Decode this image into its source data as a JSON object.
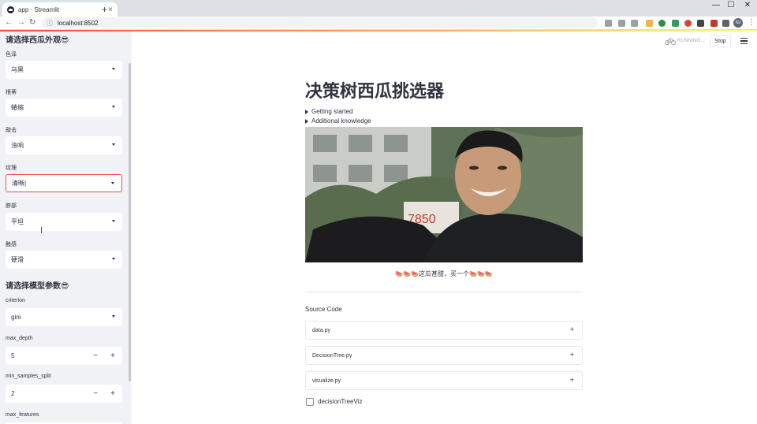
{
  "browser": {
    "tab_title": "app · Streamlit",
    "tab_close": "×",
    "new_tab": "+",
    "url": "localhost:8502",
    "win_min": "—",
    "win_max": "☐",
    "win_close": "✕",
    "nav_back": "←",
    "nav_forward": "→",
    "nav_reload": "↻",
    "more": "⋮",
    "profile_initials": "NJ"
  },
  "sidebar": {
    "appearance_heading": "请选择西瓜外观😎",
    "fields": [
      {
        "label": "色泽",
        "value": "乌黑"
      },
      {
        "label": "根蒂",
        "value": "蜷缩"
      },
      {
        "label": "敲击",
        "value": "浊响"
      },
      {
        "label": "纹理",
        "value": "清晰|"
      },
      {
        "label": "脐部",
        "value": "平坦"
      },
      {
        "label": "触感",
        "value": "硬滑"
      }
    ],
    "model_heading": "请选择模型参数😎",
    "criterion_label": "criterion",
    "criterion_value": "gini",
    "max_depth_label": "max_depth",
    "max_depth_value": "5",
    "min_samples_split_label": "min_samples_split",
    "min_samples_split_value": "2",
    "max_features_label": "max_features",
    "minus": "−",
    "plus": "+"
  },
  "toolbar": {
    "running_text": "RUNNING...",
    "stop_label": "Stop"
  },
  "main": {
    "title": "决策树西瓜挑选器",
    "expanders": [
      "Getting started",
      "Additional knowledge"
    ],
    "caption": "🍉🍉🍉这瓜甚甜，买一个🍉🍉🍉",
    "source_title": "Source Code",
    "files": [
      "data.py",
      "DecisionTree.py",
      "visualize.py"
    ],
    "file_plus": "+",
    "checkbox_label": "decisionTreeViz"
  },
  "colors": {
    "accent": "#ff4b4b",
    "sidebar_bg": "#f0f2f6",
    "text": "#31333f"
  }
}
